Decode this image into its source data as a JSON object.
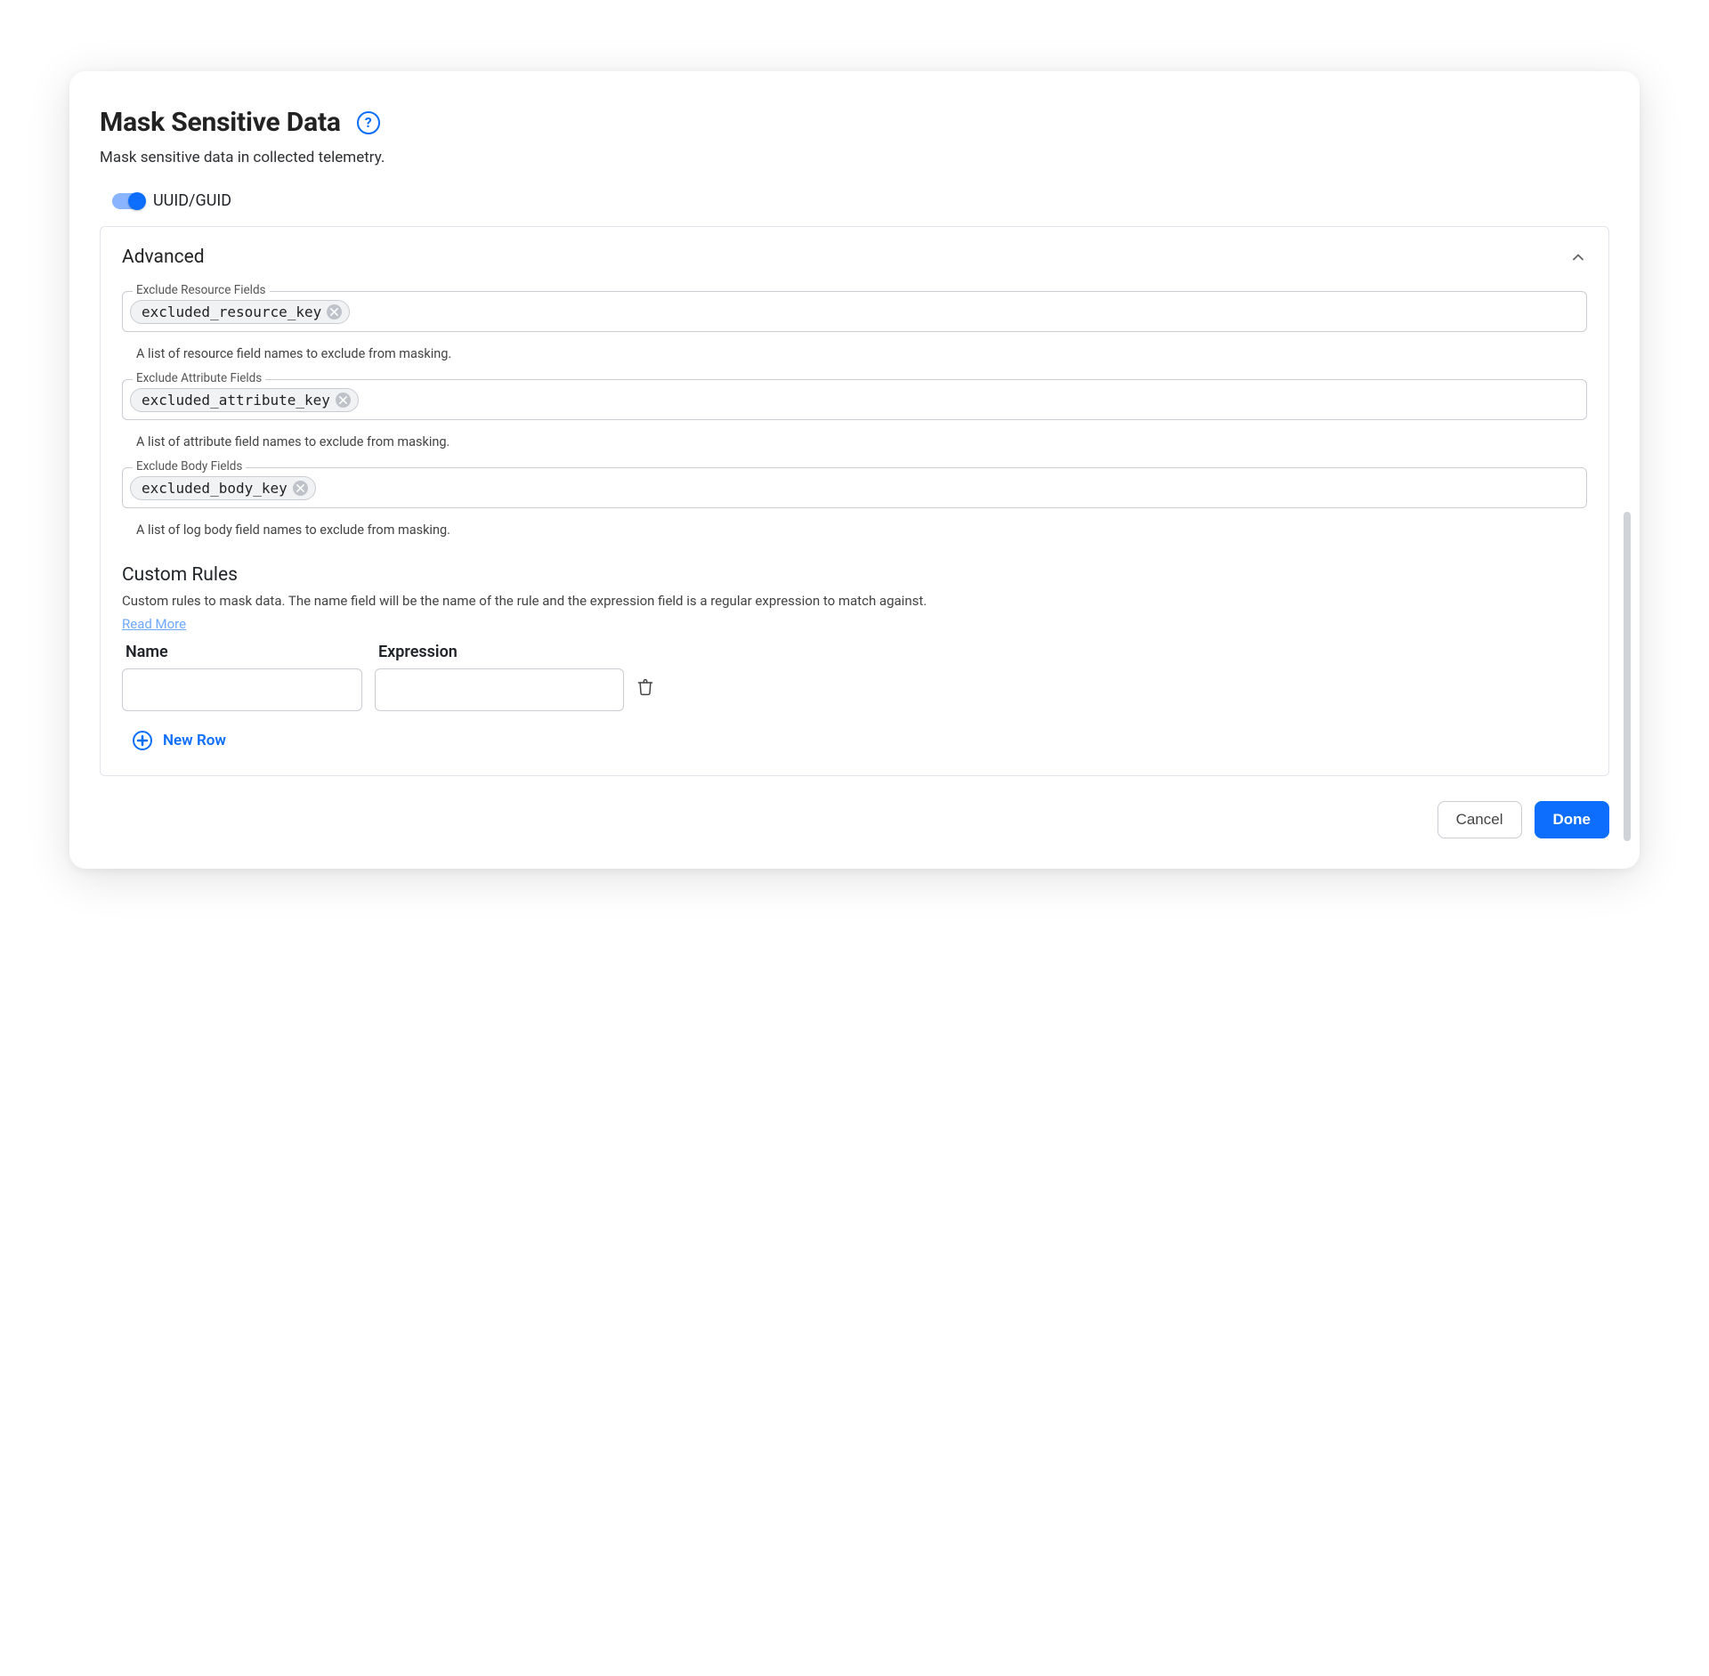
{
  "header": {
    "title": "Mask Sensitive Data",
    "subtitle": "Mask sensitive data in collected telemetry."
  },
  "toggles": {
    "uuid_label": "UUID/GUID"
  },
  "advanced": {
    "title": "Advanced",
    "fields": {
      "resource": {
        "label": "Exclude Resource Fields",
        "chip": "excluded_resource_key",
        "helper": "A list of resource field names to exclude from masking."
      },
      "attribute": {
        "label": "Exclude Attribute Fields",
        "chip": "excluded_attribute_key",
        "helper": "A list of attribute field names to exclude from masking."
      },
      "body": {
        "label": "Exclude Body Fields",
        "chip": "excluded_body_key",
        "helper": "A list of log body field names to exclude from masking."
      }
    },
    "custom_rules": {
      "title": "Custom Rules",
      "desc": "Custom rules to mask data. The name field will be the name of the rule and the expression field is a regular expression to match against.",
      "read_more": "Read More",
      "columns": {
        "name": "Name",
        "expression": "Expression"
      },
      "row": {
        "name": "",
        "expression": ""
      },
      "new_row": "New Row"
    }
  },
  "footer": {
    "cancel": "Cancel",
    "done": "Done"
  }
}
